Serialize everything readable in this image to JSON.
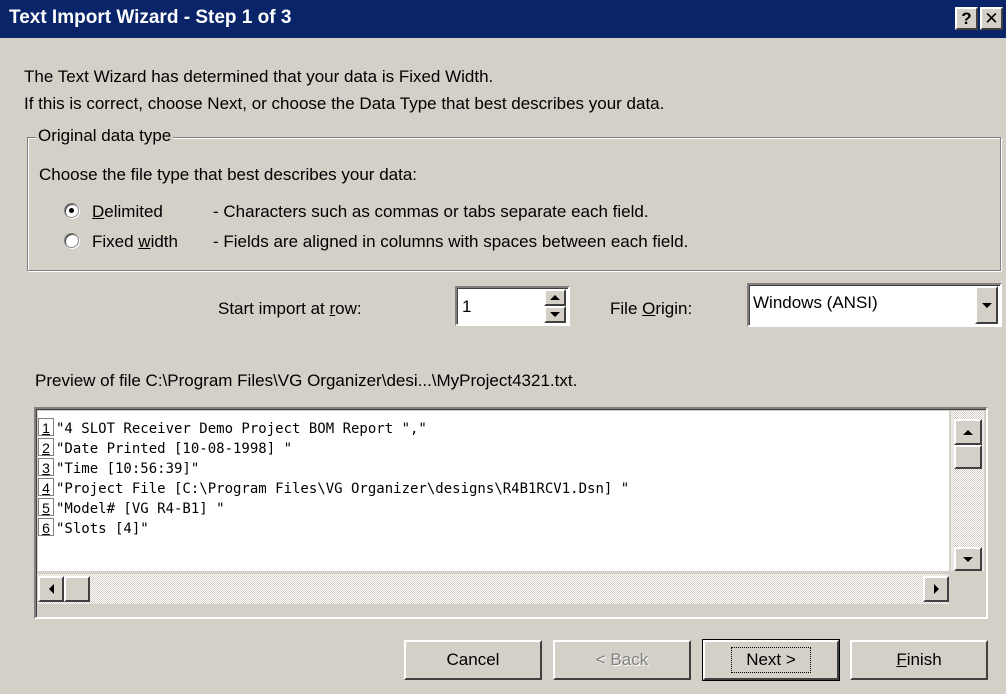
{
  "window": {
    "title": "Text Import Wizard - Step 1 of 3",
    "help_glyph": "?",
    "close_glyph": "✕"
  },
  "intro": {
    "line1": "The Text Wizard has determined that your data is Fixed Width.",
    "line2": "If this is correct, choose Next, or choose the Data Type that best describes your data."
  },
  "data_type": {
    "legend": "Original data type",
    "prompt": "Choose the file type that best describes your data:",
    "options": [
      {
        "label_pre": "",
        "label_key": "D",
        "label_post": "elimited",
        "description": "- Characters such as commas or tabs separate each field.",
        "selected": true
      },
      {
        "label_pre": "Fixed ",
        "label_key": "w",
        "label_post": "idth",
        "description": "- Fields are aligned in columns with spaces between each field.",
        "selected": false
      }
    ]
  },
  "start_row": {
    "label_pre": "Start import at ",
    "label_key": "r",
    "label_post": "ow:",
    "value": "1"
  },
  "file_origin": {
    "label_pre": "File ",
    "label_key": "O",
    "label_post": "rigin:",
    "value": "Windows (ANSI)"
  },
  "preview": {
    "caption": "Preview of file C:\\Program Files\\VG Organizer\\desi...\\MyProject4321.txt.",
    "rows": [
      {
        "num": "1",
        "text": "\"4 SLOT Receiver Demo Project BOM Report \",\""
      },
      {
        "num": "2",
        "text": "\"Date Printed [10-08-1998] \""
      },
      {
        "num": "3",
        "text": "\"Time [10:56:39]\""
      },
      {
        "num": "4",
        "text": "\"Project File [C:\\Program Files\\VG Organizer\\designs\\R4B1RCV1.Dsn] \""
      },
      {
        "num": "5",
        "text": "\"Model# [VG R4-B1] \""
      },
      {
        "num": "6",
        "text": "\"Slots [4]\""
      }
    ]
  },
  "buttons": {
    "cancel": "Cancel",
    "back": "< Back",
    "next": "Next >",
    "finish_key": "F",
    "finish_rest": "inish"
  }
}
